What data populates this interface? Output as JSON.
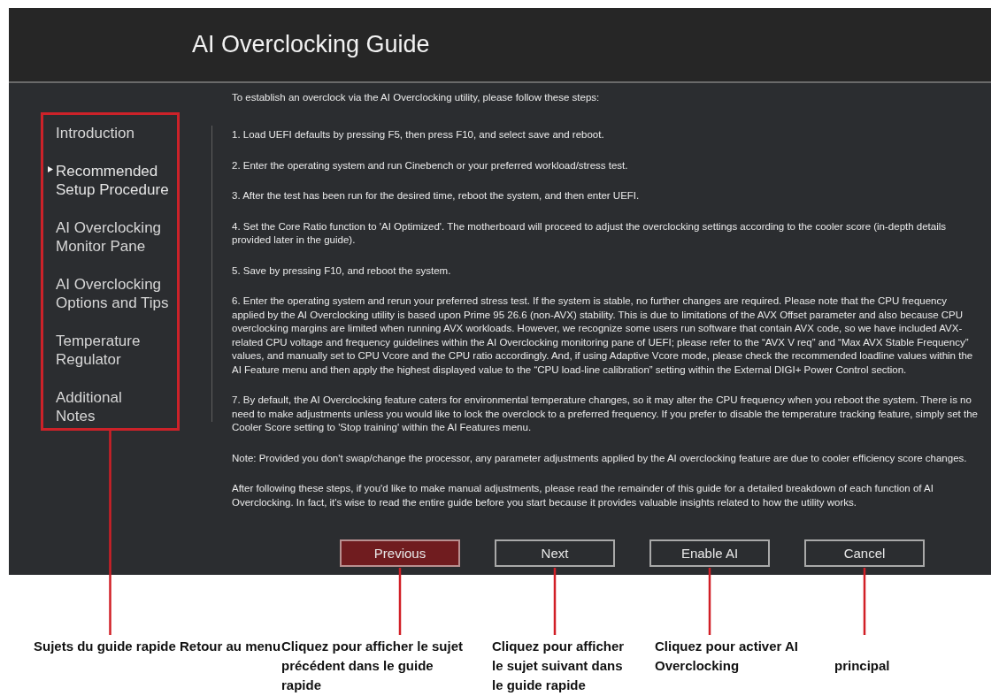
{
  "window": {
    "title": "AI Overclocking Guide"
  },
  "sidebar": {
    "items": [
      {
        "label": "Introduction",
        "selected": false
      },
      {
        "label": "Recommended\nSetup Procedure",
        "selected": true
      },
      {
        "label": "AI Overclocking\nMonitor Pane",
        "selected": false
      },
      {
        "label": "AI Overclocking\nOptions and Tips",
        "selected": false
      },
      {
        "label": "Temperature\nRegulator",
        "selected": false
      },
      {
        "label": "Additional\nNotes",
        "selected": false
      }
    ]
  },
  "content": {
    "intro": "To establish an overclock via the AI Overclocking utility, please follow these steps:",
    "steps": [
      "1. Load UEFI defaults by pressing F5, then press F10, and select save and reboot.",
      "2. Enter the operating system and run Cinebench or your preferred workload/stress test.",
      "3. After the test has been run for the desired time, reboot the system, and then enter UEFI.",
      "4. Set the Core Ratio function to 'AI Optimized'. The motherboard will proceed to adjust the overclocking settings according to the cooler score (in-depth details provided later in the guide).",
      "5. Save by pressing F10, and reboot the system.",
      "6. Enter the operating system and rerun your preferred stress test. If the system is stable, no further changes are required. Please note that the CPU frequency applied by the AI Overclocking utility is based upon Prime 95 26.6 (non-AVX) stability. This is due to limitations of the AVX Offset parameter and also because CPU overclocking margins are limited when running AVX workloads. However, we recognize some users run software that contain AVX code, so we have included AVX-related CPU voltage and frequency guidelines within the AI Overclocking monitoring pane of UEFI; please refer to the “AVX V req” and “Max AVX Stable Frequency” values, and manually set to CPU Vcore and the CPU ratio accordingly. And, if using Adaptive Vcore mode, please check the recommended loadline values within the AI Feature menu and then apply the highest displayed value to the “CPU load-line calibration” setting within the External DIGI+ Power Control section.",
      "7. By default, the AI Overclocking feature caters for environmental temperature changes, so it may alter the CPU frequency when you reboot the system. There is no need to make adjustments unless you would like to lock the overclock to a preferred frequency. If you prefer to disable the temperature tracking feature, simply set the Cooler Score setting to 'Stop training' within the AI Features menu."
    ],
    "note": "Note: Provided you don't swap/change the processor, any parameter adjustments applied by the AI overclocking feature are due to cooler efficiency score changes.",
    "closing": "After following these steps, if you'd like to make manual adjustments, please read the remainder of this guide for a detailed breakdown of each function of AI Overclocking. In fact, it's wise to read the entire guide before you start because it provides valuable insights related to how the utility works."
  },
  "buttons": [
    {
      "label": "Previous",
      "highlighted": true
    },
    {
      "label": "Next",
      "highlighted": false
    },
    {
      "label": "Enable AI",
      "highlighted": false
    },
    {
      "label": "Cancel",
      "highlighted": false
    }
  ],
  "callouts": [
    "Sujets du guide rapide",
    "Retour au menu",
    "Cliquez pour afficher le sujet\nprécédent dans le guide\nrapide",
    "Cliquez pour afficher\nle sujet suivant dans\nle guide rapide",
    "Cliquez pour activer AI\nOverclocking",
    "principal"
  ]
}
